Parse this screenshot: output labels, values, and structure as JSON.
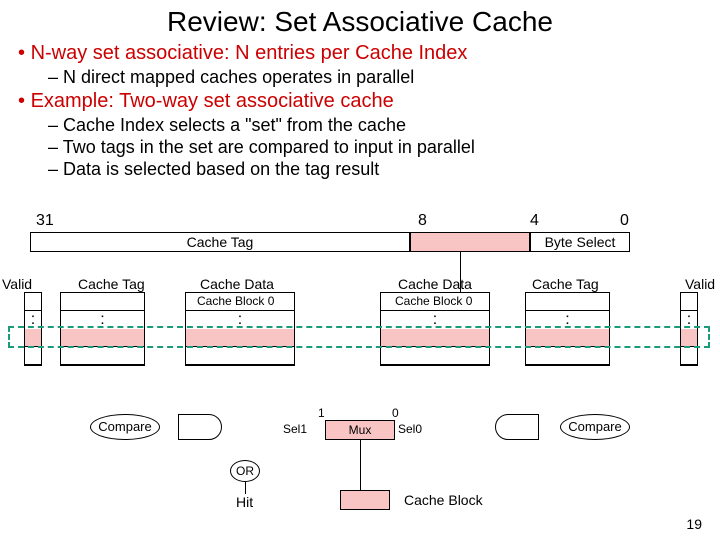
{
  "title": "Review: Set Associative Cache",
  "bullets": {
    "b1a": "N-way set associative: N entries per Cache Index",
    "b2a": "N direct mapped caches operates in parallel",
    "b1b": "Example: Two-way set associative cache",
    "b2b": "Cache Index selects a \"set\" from the cache",
    "b2c": "Two tags in the set are compared to input in parallel",
    "b2d": "Data is selected based on the tag result"
  },
  "addr": {
    "n31": "31",
    "n8": "8",
    "n4": "4",
    "n0": "0",
    "tag": "Cache Tag",
    "byte": "Byte Select"
  },
  "labels": {
    "valid": "Valid",
    "cache_tag": "Cache Tag",
    "cache_data": "Cache Data",
    "cache_block0": "Cache Block 0",
    "compare": "Compare",
    "sel1": "Sel1",
    "sel0": "Sel0",
    "one": "1",
    "zero": "0",
    "mux": "Mux",
    "or": "OR",
    "hit": "Hit",
    "cache_block": "Cache Block",
    "colon": ":"
  },
  "page": "19"
}
